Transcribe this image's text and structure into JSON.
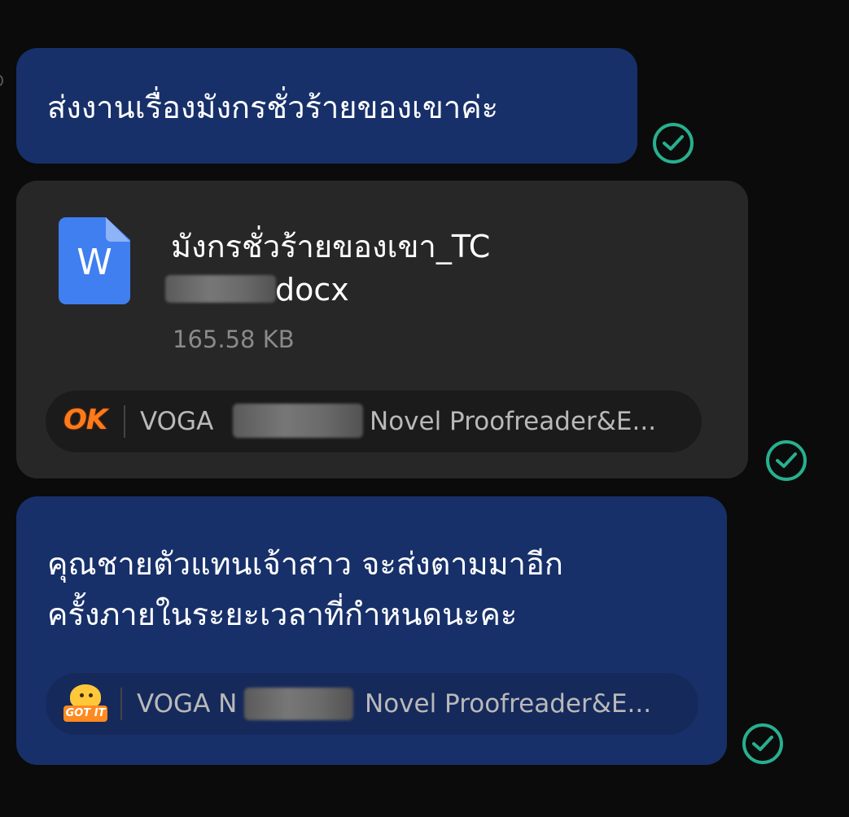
{
  "messages": [
    {
      "text": "ส่งงานเรื่องมังกรชั่วร้ายของเขาค่ะ",
      "status_icon": "read-check-icon"
    },
    {
      "file": {
        "icon_letter": "W",
        "name_line1": "มังกรชั่วร้ายของเขา_TC",
        "name_ext": "docx",
        "size": "165.58 KB"
      },
      "reply": {
        "sticker": "OK",
        "prefix": "VOGA",
        "suffix": "Novel Proofreader&E..."
      },
      "status_icon": "read-check-icon"
    },
    {
      "text_line1": "คุณชายตัวแทนเจ้าสาว จะส่งตามมาอีก",
      "text_line2": "ครั้งภายในระยะเวลาที่กำหนดนะคะ",
      "reply": {
        "sticker": "GOT IT",
        "prefix": "VOGA N",
        "suffix": "Novel Proofreader&E..."
      },
      "status_icon": "read-check-icon"
    }
  ],
  "colors": {
    "bubble_blue": "#17306a",
    "bubble_dark": "#272727",
    "check_green": "#27b08f",
    "doc_blue": "#3f7ff0"
  }
}
